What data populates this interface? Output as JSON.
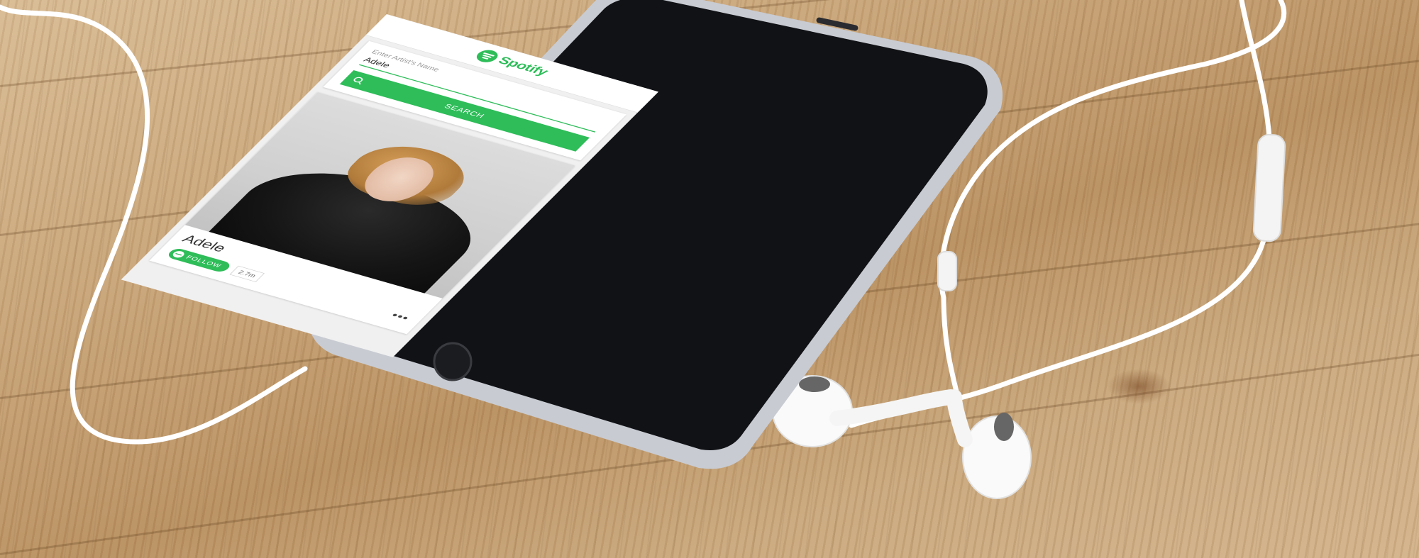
{
  "app": {
    "logo_text": "Spotify",
    "brand_color": "#2ebd59"
  },
  "search": {
    "label": "Enter Artist's Name",
    "value": "Adele",
    "button_label": "SEARCH",
    "button_icon": "search-icon"
  },
  "artist": {
    "name": "Adele",
    "follow_label": "FOLLOW",
    "followers": "2.7m",
    "more_icon": "more-dots-icon"
  }
}
